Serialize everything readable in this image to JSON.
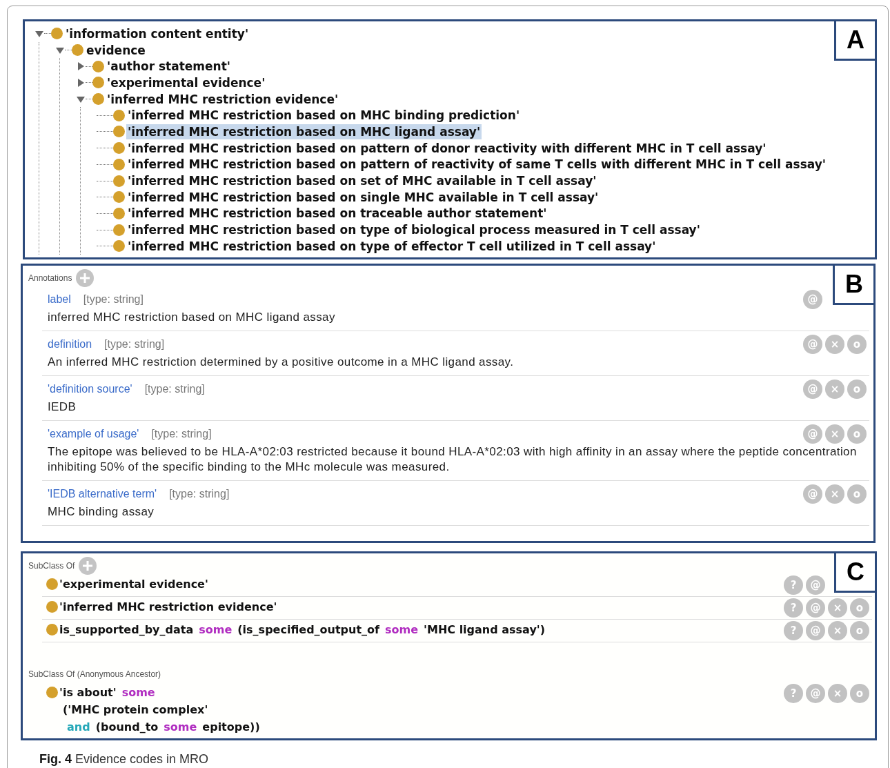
{
  "tree": {
    "label": "A",
    "items": [
      {
        "text": "'information content entity'",
        "kind": "branch",
        "expanded": true,
        "selected": false,
        "children": [
          {
            "text": "evidence",
            "kind": "branch",
            "expanded": true,
            "selected": false,
            "children": [
              {
                "text": "'author statement'",
                "kind": "branch",
                "expanded": false,
                "selected": false
              },
              {
                "text": "'experimental evidence'",
                "kind": "branch",
                "expanded": false,
                "selected": false
              },
              {
                "text": "'inferred MHC restriction evidence'",
                "kind": "branch",
                "expanded": true,
                "selected": false,
                "children": [
                  {
                    "text": "'inferred MHC restriction based on MHC binding prediction'",
                    "kind": "leaf",
                    "selected": false
                  },
                  {
                    "text": "'inferred MHC restriction based on MHC ligand assay'",
                    "kind": "leaf",
                    "selected": true
                  },
                  {
                    "text": "'inferred MHC restriction based on pattern of donor reactivity with different MHC in T cell assay'",
                    "kind": "leaf",
                    "selected": false
                  },
                  {
                    "text": "'inferred MHC restriction based on pattern of reactivity of same T cells with different MHC in T cell assay'",
                    "kind": "leaf",
                    "selected": false
                  },
                  {
                    "text": "'inferred MHC restriction based on set of MHC available in T cell assay'",
                    "kind": "leaf",
                    "selected": false
                  },
                  {
                    "text": "'inferred MHC restriction based on single MHC available in T cell assay'",
                    "kind": "leaf",
                    "selected": false
                  },
                  {
                    "text": "'inferred MHC restriction based on traceable author statement'",
                    "kind": "leaf",
                    "selected": false
                  },
                  {
                    "text": "'inferred MHC restriction based on type of biological process measured in T cell assay'",
                    "kind": "leaf",
                    "selected": false
                  },
                  {
                    "text": "'inferred MHC restriction based on type of effector T cell utilized in T cell assay'",
                    "kind": "leaf",
                    "selected": false
                  }
                ]
              }
            ]
          }
        ]
      }
    ]
  },
  "annotations": {
    "label": "B",
    "title": "Annotations",
    "rows": [
      {
        "property": "label",
        "type": "[type: string]",
        "value": "inferred MHC restriction based on MHC ligand assay",
        "buttons": [
          "@"
        ]
      },
      {
        "property": "definition",
        "type": "[type: string]",
        "value": "An inferred MHC restriction determined by a positive outcome in a MHC ligand assay.",
        "buttons": [
          "@",
          "×",
          "o"
        ]
      },
      {
        "property": "'definition source'",
        "type": "[type: string]",
        "value": "IEDB",
        "buttons": [
          "@",
          "×",
          "o"
        ]
      },
      {
        "property": "'example of usage'",
        "type": "[type: string]",
        "value": "The epitope was believed to be HLA-A*02:03 restricted because it bound HLA-A*02:03 with high affinity in an assay where the peptide concentration inhibiting 50% of the specific binding to the MHc molecule was measured.",
        "buttons": [
          "@",
          "×",
          "o"
        ]
      },
      {
        "property": "'IEDB alternative term'",
        "type": "[type: string]",
        "value": "MHC binding assay",
        "buttons": [
          "@",
          "×",
          "o"
        ]
      }
    ]
  },
  "superclasses": {
    "label": "C",
    "sections": [
      {
        "title": "SubClass Of",
        "has_add": true,
        "rows": [
          {
            "lines": [
              [
                {
                  "kind": "plain",
                  "text": "'experimental evidence'"
                }
              ]
            ],
            "buttons": [
              "?",
              "@"
            ]
          },
          {
            "lines": [
              [
                {
                  "kind": "plain",
                  "text": "'inferred MHC restriction evidence'"
                }
              ]
            ],
            "buttons": [
              "?",
              "@",
              "×",
              "o"
            ]
          },
          {
            "lines": [
              [
                {
                  "kind": "plain",
                  "text": "is_supported_by_data"
                },
                {
                  "kind": "quantifier",
                  "text": "some"
                },
                {
                  "kind": "plain",
                  "text": "(is_specified_output_of"
                },
                {
                  "kind": "quantifier",
                  "text": "some"
                },
                {
                  "kind": "plain",
                  "text": "'MHC ligand assay')"
                }
              ]
            ],
            "buttons": [
              "?",
              "@",
              "×",
              "o"
            ]
          }
        ]
      },
      {
        "title": "SubClass Of (Anonymous Ancestor)",
        "has_add": false,
        "rows": [
          {
            "lines": [
              [
                {
                  "kind": "plain",
                  "text": "'is about'"
                },
                {
                  "kind": "quantifier",
                  "text": "some"
                }
              ],
              [
                {
                  "kind": "plain",
                  "text": "('MHC protein complex'"
                }
              ],
              [
                {
                  "kind": "connective",
                  "text": "and"
                },
                {
                  "kind": "plain",
                  "text": "(bound_to"
                },
                {
                  "kind": "quantifier",
                  "text": "some"
                },
                {
                  "kind": "plain",
                  "text": "epitope))"
                }
              ]
            ],
            "buttons": [
              "?",
              "@",
              "×",
              "o"
            ]
          }
        ]
      }
    ]
  },
  "caption": "**Fig. 4** Evidence codes in MRO"
}
